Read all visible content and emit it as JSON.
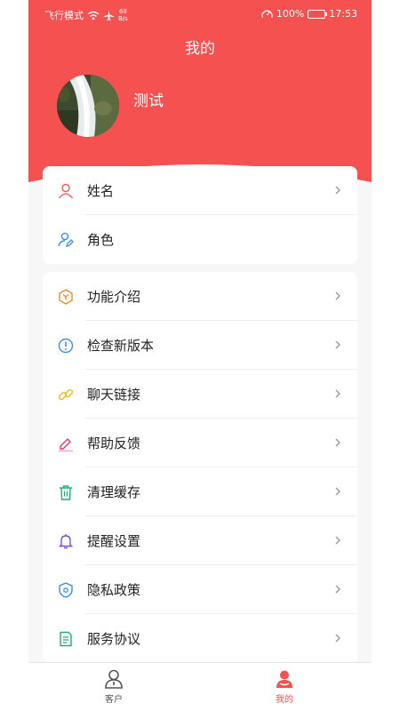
{
  "status_bar": {
    "left_text": "飞行模式",
    "speed_value": "68",
    "speed_unit": "B/s",
    "battery": "100%",
    "time": "17:53"
  },
  "header": {
    "title": "我的",
    "username": "测试",
    "background_color": "#f45150"
  },
  "profile_items": [
    {
      "label": "姓名",
      "icon": "user-icon",
      "color": "#f25c54",
      "chevron": true
    },
    {
      "label": "角色",
      "icon": "role-edit-icon",
      "color": "#3b8ff0",
      "chevron": false
    }
  ],
  "menu_items": [
    {
      "label": "功能介绍",
      "icon": "feature-cube-icon",
      "color": "#f08a24"
    },
    {
      "label": "检查新版本",
      "icon": "info-alert-icon",
      "color": "#3b8ff0"
    },
    {
      "label": "聊天链接",
      "icon": "link-icon",
      "color": "#f5b82e"
    },
    {
      "label": "帮助反馈",
      "icon": "pencil-feedback-icon",
      "color": "#ec3b6a"
    },
    {
      "label": "清理缓存",
      "icon": "trash-icon",
      "color": "#1fae7a"
    },
    {
      "label": "提醒设置",
      "icon": "bell-icon",
      "color": "#7a4fd8"
    },
    {
      "label": "隐私政策",
      "icon": "shield-icon",
      "color": "#3b8ff0"
    },
    {
      "label": "服务协议",
      "icon": "document-icon",
      "color": "#1fae7a"
    }
  ],
  "tabs": [
    {
      "label": "客户",
      "icon": "customer-icon",
      "active": false
    },
    {
      "label": "我的",
      "icon": "profile-icon",
      "active": true
    }
  ],
  "colors": {
    "accent": "#f45150",
    "tab_inactive": "#555555"
  }
}
